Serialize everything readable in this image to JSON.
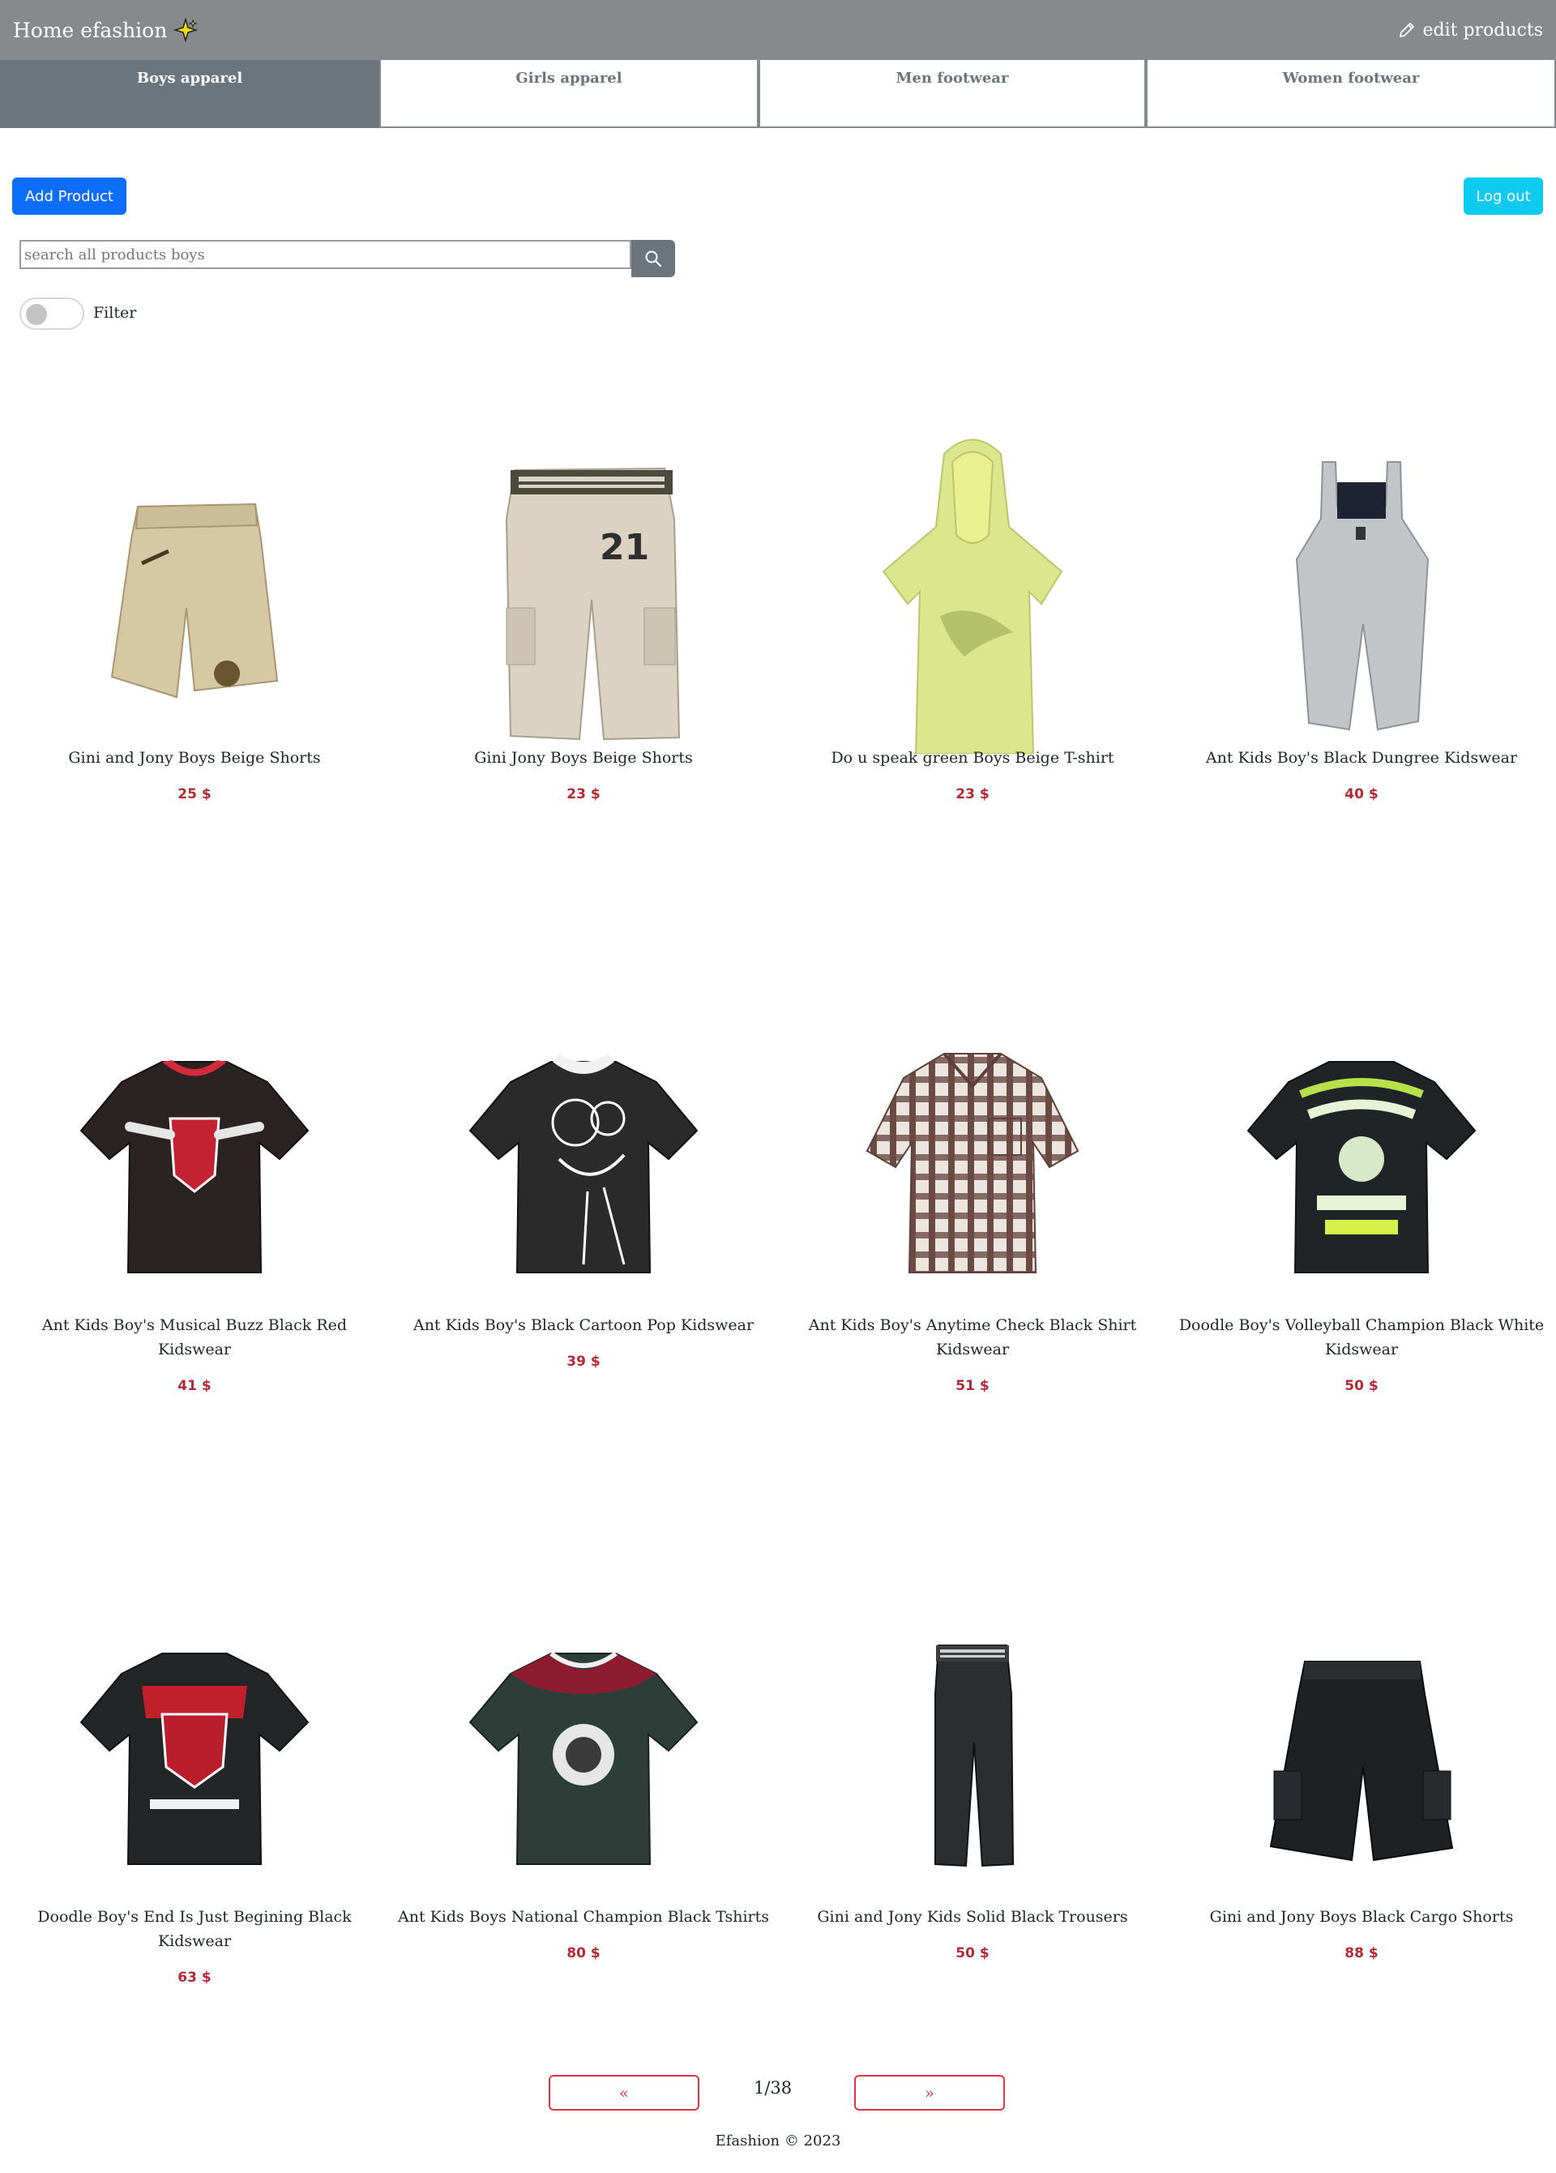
{
  "header": {
    "brand": "Home efashion",
    "edit_label": "edit products"
  },
  "tabs": [
    {
      "label": "Boys apparel",
      "active": true
    },
    {
      "label": "Girls apparel",
      "active": false
    },
    {
      "label": "Men footwear",
      "active": false
    },
    {
      "label": "Women footwear",
      "active": false
    }
  ],
  "actions": {
    "add_label": "Add Product",
    "logout_label": "Log out"
  },
  "search": {
    "placeholder": "search all products boys"
  },
  "filter": {
    "label": "Filter",
    "enabled": false
  },
  "products": [
    {
      "name": "Gini and Jony Boys Beige Shorts",
      "price": "25 $",
      "icon": "beige-shorts-icon"
    },
    {
      "name": "Gini Jony Boys Beige Shorts",
      "price": "23 $",
      "icon": "beige-cargo-pants-icon"
    },
    {
      "name": "Do u speak green Boys Beige T-shirt",
      "price": "23 $",
      "icon": "green-hoodie-icon"
    },
    {
      "name": "Ant Kids Boy's Black Dungree Kidswear",
      "price": "40 $",
      "icon": "dungaree-icon"
    },
    {
      "name": "Ant Kids Boy's Musical Buzz Black Red Kidswear",
      "price": "41 $",
      "icon": "black-red-tshirt-icon"
    },
    {
      "name": "Ant Kids Boy's Black Cartoon Pop Kidswear",
      "price": "39 $",
      "icon": "cartoon-tshirt-icon"
    },
    {
      "name": "Ant Kids Boy's Anytime Check Black Shirt Kidswear",
      "price": "51 $",
      "icon": "check-shirt-icon"
    },
    {
      "name": "Doodle Boy's Volleyball Champion Black White Kidswear",
      "price": "50 $",
      "icon": "volleyball-tshirt-icon"
    },
    {
      "name": "Doodle Boy's End Is Just Begining Black Kidswear",
      "price": "63 $",
      "icon": "phoenix-tshirt-icon"
    },
    {
      "name": "Ant Kids Boys National Champion Black Tshirts",
      "price": "80 $",
      "icon": "champion-tshirt-icon"
    },
    {
      "name": "Gini and Jony Kids Solid Black Trousers",
      "price": "50 $",
      "icon": "black-trousers-icon"
    },
    {
      "name": "Gini and Jony Boys Black Cargo Shorts",
      "price": "88 $",
      "icon": "black-cargo-shorts-icon"
    }
  ],
  "pagination": {
    "prev": "«",
    "next": "»",
    "page": "1/38"
  },
  "footer": {
    "text": "Efashion © 2023"
  },
  "colors": {
    "navbar": "#878a8d",
    "active_tab": "#6c757d",
    "primary": "#0d6efd",
    "info": "#0dcaf0",
    "price": "#b02a37",
    "pager": "#dc3545"
  }
}
